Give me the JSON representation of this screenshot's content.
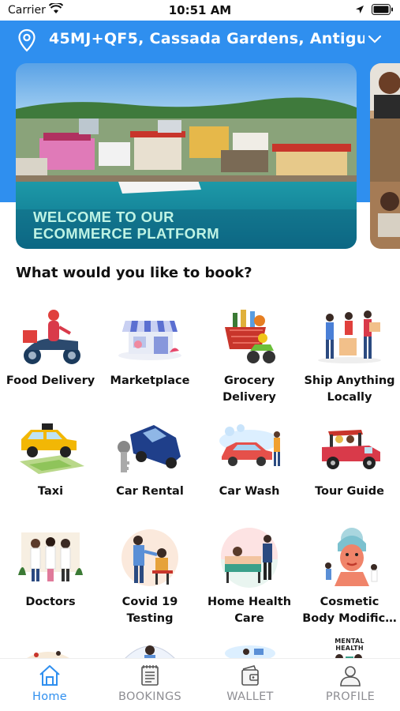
{
  "status_bar": {
    "carrier": "Carrier",
    "time": "10:51 AM"
  },
  "header": {
    "location": "45MJ+QF5,  Cassada Gardens,  Antigu…"
  },
  "banner": {
    "line1": "WELCOME TO OUR",
    "line2": "ECOMMERCE PLATFORM"
  },
  "section": {
    "title": "What would you like to book?"
  },
  "services": [
    {
      "label": "Food Delivery",
      "icon": "scooter-delivery-icon"
    },
    {
      "label": "Marketplace",
      "icon": "storefront-icon"
    },
    {
      "label": "Grocery\nDelivery",
      "icon": "grocery-basket-icon"
    },
    {
      "label": "Ship Anything\nLocally",
      "icon": "movers-icon"
    },
    {
      "label": "Taxi",
      "icon": "taxi-icon"
    },
    {
      "label": "Car Rental",
      "icon": "rental-car-icon"
    },
    {
      "label": "Car Wash",
      "icon": "car-wash-icon"
    },
    {
      "label": "Tour Guide",
      "icon": "tour-jeep-icon"
    },
    {
      "label": "Doctors",
      "icon": "doctors-icon"
    },
    {
      "label": "Covid 19\nTesting",
      "icon": "covid-test-icon"
    },
    {
      "label": "Home Health\nCare",
      "icon": "home-care-icon"
    },
    {
      "label": "Cosmetic\nBody Modific…",
      "icon": "cosmetic-icon"
    }
  ],
  "peek_row": {
    "mental_health_text": "MENTAL HEALTH"
  },
  "tabs": [
    {
      "label": "Home",
      "icon": "home-icon",
      "active": true
    },
    {
      "label": "BOOKINGS",
      "icon": "bookings-list-icon",
      "active": false
    },
    {
      "label": "WALLET",
      "icon": "wallet-icon",
      "active": false
    },
    {
      "label": "PROFILE",
      "icon": "profile-icon",
      "active": false
    }
  ],
  "colors": {
    "accent": "#2f8fef",
    "inactive": "#8e8e93",
    "banner_text": "#bff3e4"
  }
}
